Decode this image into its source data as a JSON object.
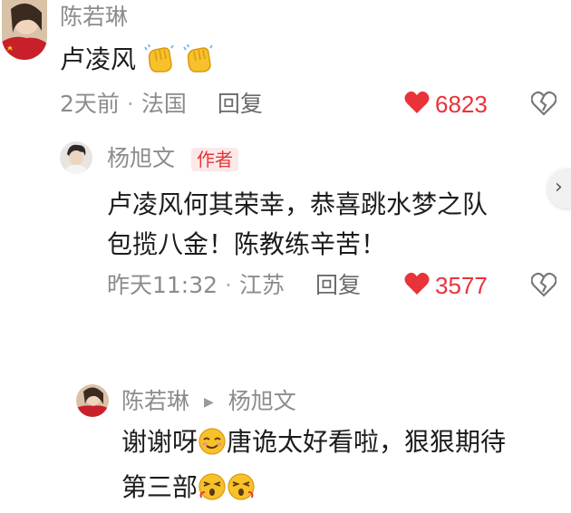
{
  "comments": [
    {
      "author": "陈若琳",
      "text": "卢凌风",
      "emojis": [
        "clap-hands-icon",
        "clap-hands-icon"
      ],
      "time": "2天前",
      "location": "法国",
      "reply_label": "回复",
      "likes": "6823"
    }
  ],
  "reply1": {
    "author": "杨旭文",
    "badge": "作者",
    "line1": "卢凌风何其荣幸，恭喜跳水梦之队",
    "line2": "包揽八金！陈教练辛苦！",
    "time": "昨天11:32",
    "location": "江苏",
    "reply_label": "回复",
    "likes": "3577"
  },
  "reply2": {
    "author": "陈若琳",
    "reply_to": "杨旭文",
    "line1_part1": "谢谢呀",
    "line1_part2": "唐诡太好看啦，狠狠期待",
    "line2": "第三部"
  },
  "separator": "·",
  "colors": {
    "like_red": "#e8333a",
    "meta_gray": "#8c8c8c",
    "text_dark": "#1c1c1c",
    "badge_bg": "#fde8e8",
    "badge_text": "#e03a3a"
  }
}
